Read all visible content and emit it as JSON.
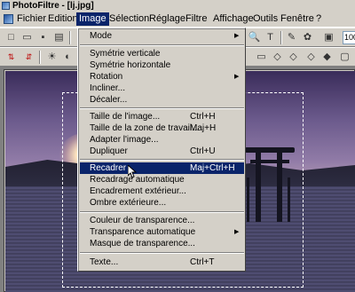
{
  "window": {
    "title": "PhotoFiltre - [lj.jpg]"
  },
  "menubar": {
    "items": [
      "Fichier",
      "Edition",
      "Image",
      "Sélection",
      "Réglage",
      "Filtre",
      "Affichage",
      "Outils",
      "Fenêtre",
      "?"
    ],
    "active": "Image"
  },
  "toolbar": {
    "zoom_value": "100",
    "text_tool_glyph": "T",
    "zoom_tool_glyph": "🔍"
  },
  "image_menu": {
    "items": [
      {
        "label": "Mode",
        "shortcut": "",
        "submenu": true
      },
      {
        "label": "Symétrie verticale",
        "shortcut": "",
        "submenu": false
      },
      {
        "label": "Symétrie horizontale",
        "shortcut": "",
        "submenu": false
      },
      {
        "label": "Rotation",
        "shortcut": "",
        "submenu": true
      },
      {
        "label": "Incliner...",
        "shortcut": "",
        "submenu": false
      },
      {
        "label": "Décaler...",
        "shortcut": "",
        "submenu": false
      },
      {
        "label": "Taille de l'image...",
        "shortcut": "Ctrl+H",
        "submenu": false
      },
      {
        "label": "Taille de la zone de travail...",
        "shortcut": "Maj+H",
        "submenu": false
      },
      {
        "label": "Adapter l'image...",
        "shortcut": "",
        "submenu": false
      },
      {
        "label": "Dupliquer",
        "shortcut": "Ctrl+U",
        "submenu": false
      },
      {
        "label": "Recadrer",
        "shortcut": "Maj+Ctrl+H",
        "submenu": false,
        "highlighted": true
      },
      {
        "label": "Recadrage automatique",
        "shortcut": "",
        "submenu": false
      },
      {
        "label": "Encadrement extérieur...",
        "shortcut": "",
        "submenu": false
      },
      {
        "label": "Ombre extérieure...",
        "shortcut": "",
        "submenu": false
      },
      {
        "label": "Couleur de transparence...",
        "shortcut": "",
        "submenu": false
      },
      {
        "label": "Transparence automatique",
        "shortcut": "",
        "submenu": true
      },
      {
        "label": "Masque de transparence...",
        "shortcut": "",
        "submenu": false
      },
      {
        "label": "Texte...",
        "shortcut": "Ctrl+T",
        "submenu": false
      }
    ]
  },
  "colors": {
    "menu_highlight": "#0a246a",
    "chrome": "#d4d0c8"
  }
}
